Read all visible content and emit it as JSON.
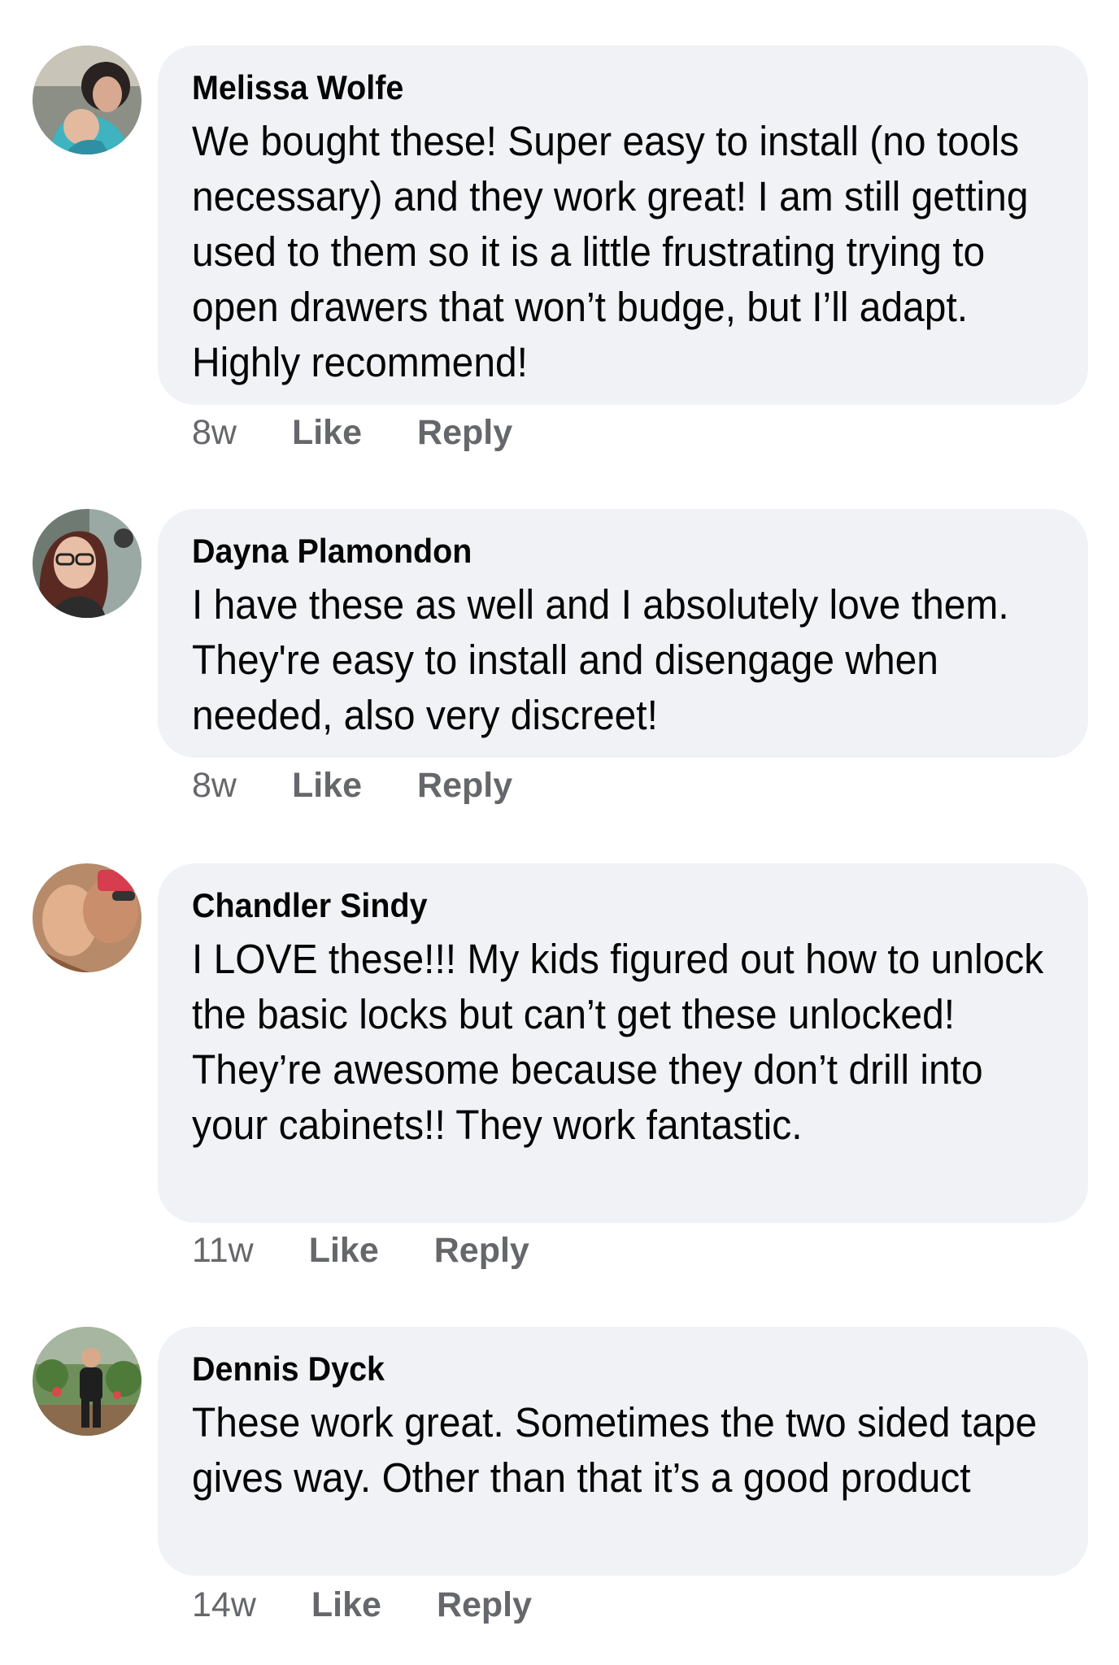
{
  "comments": [
    {
      "author": "Melissa Wolfe",
      "text": "We bought these! Super easy to install (no tools necessary) and they work great! I am still getting used to them so it is a little frustrating trying to open drawers that won’t budge, but I’ll adapt. Highly recommend!",
      "time": "8w",
      "like_label": "Like",
      "reply_label": "Reply"
    },
    {
      "author": "Dayna Plamondon",
      "text": "I have these as well and I absolutely love them. They're easy to install and disengage when needed, also very discreet!",
      "time": "8w",
      "like_label": "Like",
      "reply_label": "Reply"
    },
    {
      "author": "Chandler Sindy",
      "text": "I LOVE these!!! My kids figured out how to unlock the basic locks but can’t get these unlocked! They’re awesome because they don’t drill into your cabinets!! They work fantastic.",
      "time": "11w",
      "like_label": "Like",
      "reply_label": "Reply"
    },
    {
      "author": "Dennis Dyck",
      "text": "These work great. Sometimes the two sided tape gives way. Other than that it’s a good product",
      "time": "14w",
      "like_label": "Like",
      "reply_label": "Reply"
    }
  ],
  "colors": {
    "bubble": "#f0f2f5",
    "text": "#050505",
    "secondary": "#65676b"
  }
}
